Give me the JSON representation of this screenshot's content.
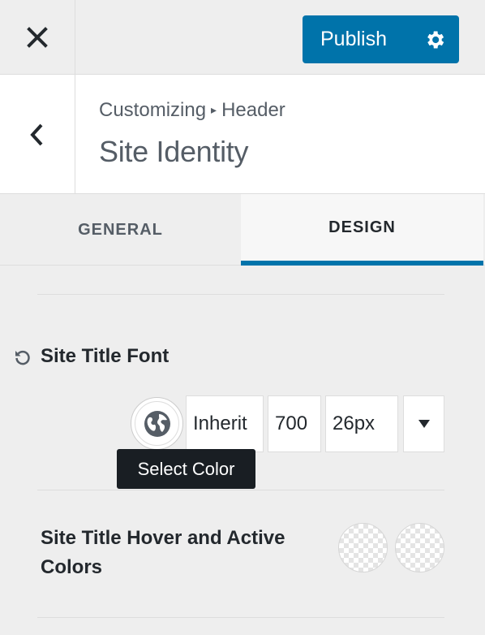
{
  "topbar": {
    "close_icon": "close-icon",
    "publish_label": "Publish",
    "settings_icon": "gear-icon"
  },
  "panel": {
    "back_icon": "chevron-left-icon",
    "breadcrumb_root": "Customizing",
    "breadcrumb_separator": "▸",
    "breadcrumb_section": "Header",
    "title": "Site Identity"
  },
  "tabs": [
    {
      "label": "GENERAL",
      "active": false
    },
    {
      "label": "DESIGN",
      "active": true
    }
  ],
  "site_title_font": {
    "label": "Site Title Font",
    "reset_icon": "reset-icon",
    "color_icon": "globe-icon",
    "font_family": "Inherit",
    "font_weight": "700",
    "font_size": "26px",
    "toggle_icon": "caret-down-icon",
    "tooltip": "Select Color"
  },
  "hover_colors": {
    "label": "Site Title Hover and Active Colors"
  },
  "colors": {
    "accent": "#0073aa",
    "background": "#eeeeee",
    "text": "#23282d",
    "tooltip_bg": "#191e23"
  }
}
